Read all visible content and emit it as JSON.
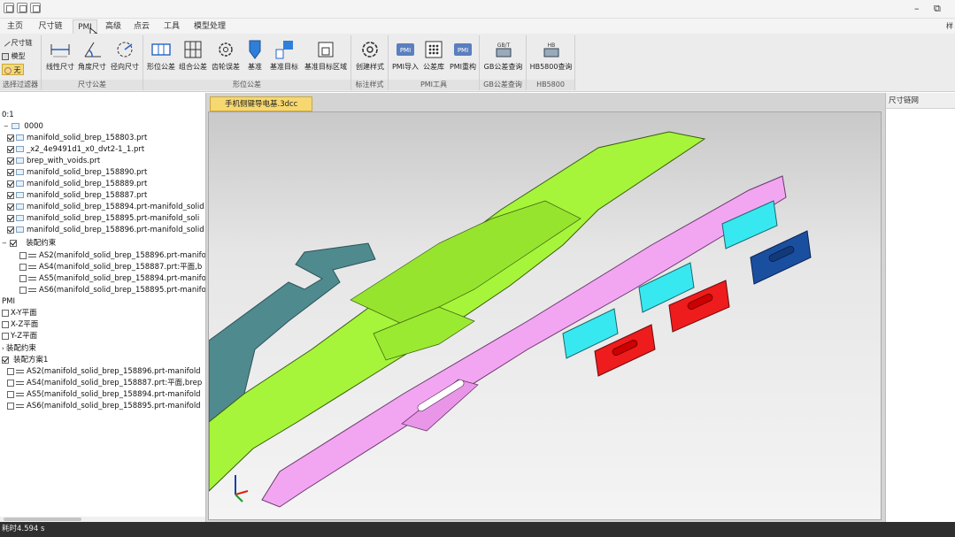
{
  "menu": {
    "tabs": [
      "主页",
      "尺寸链",
      "PMI",
      "高级",
      "点云",
      "工具",
      "模型处理"
    ],
    "active": "PMI",
    "right_text": "样"
  },
  "ribbon": {
    "selector": {
      "items": [
        "尺寸链",
        "模型",
        "无"
      ],
      "label": "选择过滤器"
    },
    "groups": [
      {
        "label": "尺寸公差",
        "buttons": [
          "线性尺寸",
          "角度尺寸",
          "径向尺寸"
        ]
      },
      {
        "label": "形位公差",
        "buttons": [
          "形位公差",
          "组合公差",
          "齿轮误差",
          "基准",
          "基准目标",
          "基准目标区域"
        ]
      },
      {
        "label": "标注样式",
        "buttons": [
          "创建样式"
        ]
      },
      {
        "label": "PMI工具",
        "buttons": [
          "PMI导入",
          "公差库",
          "PMI重构"
        ]
      },
      {
        "label": "GB公差查询",
        "buttons": [
          "GB公差查询"
        ]
      },
      {
        "label": "HB5800",
        "buttons": [
          "HB5800查询"
        ]
      }
    ],
    "icon_labels": {
      "gbt": "GB/T",
      "hb": "HB",
      "pmi": "PMI"
    }
  },
  "tree": {
    "root": "0:1",
    "assembly": "0000",
    "parts": [
      {
        "name": "manifold_solid_brep_158803.prt",
        "checked": true
      },
      {
        "name": "_x2_4e9491d1_x0_dvt2-1_1.prt",
        "checked": true
      },
      {
        "name": "brep_with_voids.prt",
        "checked": true
      },
      {
        "name": "manifold_solid_brep_158890.prt",
        "checked": true
      },
      {
        "name": "manifold_solid_brep_158889.prt",
        "checked": true
      },
      {
        "name": "manifold_solid_brep_158887.prt",
        "checked": true
      },
      {
        "name": "manifold_solid_brep_158894.prt-manifold_solid",
        "checked": true
      },
      {
        "name": "manifold_solid_brep_158895.prt-manifold_soli",
        "checked": true
      },
      {
        "name": "manifold_solid_brep_158896.prt-manifold_solid",
        "checked": true
      }
    ],
    "constraint_group": "装配约束",
    "constraints": [
      "AS2(manifold_solid_brep_158896.prt-manifo",
      "AS4(manifold_solid_brep_158887.prt:平面,b",
      "AS5(manifold_solid_brep_158894.prt-manifo",
      "AS6(manifold_solid_brep_158895.prt-manifo"
    ],
    "pmi_root": "PMI",
    "planes": [
      "X-Y平面",
      "X-Z平面",
      "Y-Z平面"
    ],
    "pmi_constraint": "装配约束",
    "scheme": "装配方案1",
    "scheme_items": [
      "AS2(manifold_solid_brep_158896.prt-manifold",
      "AS4(manifold_solid_brep_158887.prt:平面,brep",
      "AS5(manifold_solid_brep_158894.prt-manifold",
      "AS6(manifold_solid_brep_158895.prt-manifold"
    ]
  },
  "viewport": {
    "doc_tab": "手机侧键导电基.3dcc"
  },
  "right_panel": {
    "title": "尺寸链网"
  },
  "status": {
    "text": "耗时4.594 s"
  },
  "colors": {
    "green_part": "#a6f53a",
    "pink_part": "#f2a6f2",
    "teal_part": "#4f8a8f",
    "cyan_part": "#38e8f0",
    "red_part": "#ee1c1c",
    "blue_part": "#1a4fa0"
  }
}
